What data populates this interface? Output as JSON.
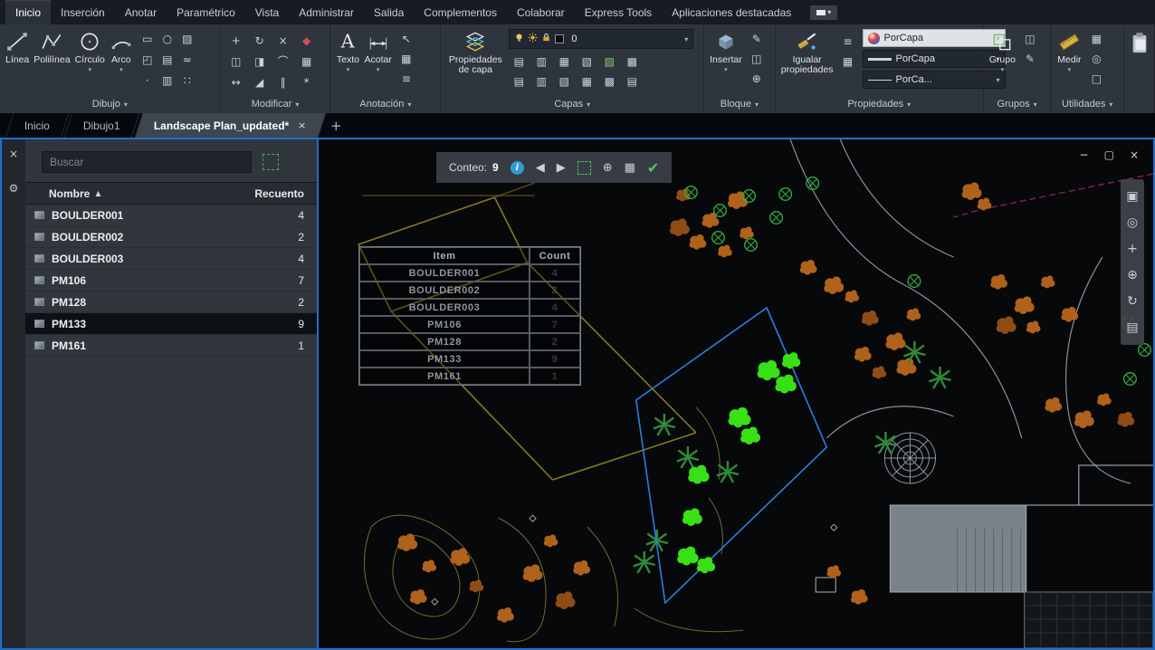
{
  "menubar": {
    "items": [
      "Inicio",
      "Inserción",
      "Anotar",
      "Paramétrico",
      "Vista",
      "Administrar",
      "Salida",
      "Complementos",
      "Colaborar",
      "Express Tools",
      "Aplicaciones destacadas"
    ],
    "active": "Inicio",
    "overflow_caret": "▾"
  },
  "ribbon": {
    "caret": "▾",
    "dibujo": {
      "label": "Dibujo",
      "line": "Línea",
      "polyline": "Polilínea",
      "circle": "Círculo",
      "arc": "Arco",
      "icons": [
        {
          "name": "rectangle-icon",
          "glyph": "▭"
        },
        {
          "name": "ellipse-icon",
          "glyph": "○"
        },
        {
          "name": "hatch-icon",
          "glyph": "▨"
        },
        {
          "name": "boundary-icon",
          "glyph": "◰"
        },
        {
          "name": "region-icon",
          "glyph": "▤"
        },
        {
          "name": "spline-icon",
          "glyph": "≈"
        },
        {
          "name": "point-icon",
          "glyph": "·"
        },
        {
          "name": "gradient-icon",
          "glyph": "▥"
        },
        {
          "name": "divide-icon",
          "glyph": "∷"
        }
      ]
    },
    "modificar": {
      "label": "Modificar",
      "icons": [
        {
          "name": "move-icon",
          "glyph": "+"
        },
        {
          "name": "rotate-icon",
          "glyph": "↻"
        },
        {
          "name": "trim-icon",
          "glyph": "×"
        },
        {
          "name": "erase-icon",
          "glyph": "◆",
          "color": "#cf5050"
        },
        {
          "name": "copy-icon",
          "glyph": "◫"
        },
        {
          "name": "mirror-icon",
          "glyph": "◨"
        },
        {
          "name": "fillet-icon",
          "glyph": "⌒"
        },
        {
          "name": "array-icon",
          "glyph": "▦"
        },
        {
          "name": "stretch-icon",
          "glyph": "↔"
        },
        {
          "name": "scale-icon",
          "glyph": "◢"
        },
        {
          "name": "offset-icon",
          "glyph": "∥"
        },
        {
          "name": "explode-icon",
          "glyph": "*"
        }
      ]
    },
    "anotacion": {
      "label": "Anotación",
      "text": "Texto",
      "dimension": "Acotar",
      "icons": [
        {
          "name": "leader-icon",
          "glyph": "↖"
        },
        {
          "name": "table-icon",
          "glyph": "▦"
        },
        {
          "name": "text-style-icon",
          "glyph": "≡"
        }
      ]
    },
    "capas": {
      "label": "Capas",
      "layer_properties": "Propiedades de capa",
      "current_layer": "0",
      "icons": [
        {
          "name": "layer-off-icon",
          "glyph": "▤"
        },
        {
          "name": "layer-isolate-icon",
          "glyph": "▥"
        },
        {
          "name": "layer-freeze-icon",
          "glyph": "▦"
        },
        {
          "name": "layer-lock-icon",
          "glyph": "▧"
        },
        {
          "name": "layer-current-icon",
          "glyph": "▨",
          "color": "#8fc97a"
        },
        {
          "name": "layer-match-icon",
          "glyph": "▩"
        },
        {
          "name": "layer-on-icon",
          "glyph": "▤"
        },
        {
          "name": "layer-thaw-icon",
          "glyph": "▥"
        },
        {
          "name": "layer-unlock-icon",
          "glyph": "▧"
        },
        {
          "name": "layer-walk-icon",
          "glyph": "▦"
        },
        {
          "name": "layer-state-icon",
          "glyph": "▩"
        },
        {
          "name": "layer-merge-icon",
          "glyph": "▤"
        }
      ]
    },
    "bloque": {
      "label": "Bloque",
      "insert": "Insertar",
      "icons": [
        {
          "name": "edit-block-icon",
          "glyph": "✎"
        },
        {
          "name": "create-block-icon",
          "glyph": "◫"
        },
        {
          "name": "base-point-icon",
          "glyph": "⊕"
        }
      ]
    },
    "propiedades": {
      "label": "Propiedades",
      "match": "Igualar propiedades",
      "color_value": "PorCapa",
      "lineweight_value": "PorCapa",
      "linetype_value": "PorCa...",
      "icons": [
        {
          "name": "properties-list-icon",
          "glyph": "≡"
        },
        {
          "name": "annotative-icon",
          "glyph": "▦"
        }
      ]
    },
    "grupos": {
      "label": "Grupos",
      "group": "Grupo",
      "icons": [
        {
          "name": "ungroup-icon",
          "glyph": "◫"
        },
        {
          "name": "group-edit-icon",
          "glyph": "✎"
        }
      ]
    },
    "utilidades": {
      "label": "Utilidades",
      "measure": "Medir",
      "icons": [
        {
          "name": "quick-calc-icon",
          "glyph": "▦"
        },
        {
          "name": "id-point-icon",
          "glyph": "◎"
        },
        {
          "name": "quick-select-icon",
          "glyph": "□"
        }
      ]
    }
  },
  "tabs": {
    "items": [
      {
        "label": "Inicio",
        "active": false
      },
      {
        "label": "Dibujo1",
        "active": false
      },
      {
        "label": "Landscape Plan_updated*",
        "active": true
      }
    ],
    "close_glyph": "×",
    "new_tab_glyph": "+"
  },
  "palette": {
    "search_placeholder": "Buscar",
    "name_header": "Nombre",
    "count_header": "Recuento",
    "sort_glyph": "▲",
    "close_glyph": "×",
    "settings_glyph": "⚙",
    "selected": "PM133",
    "rows": [
      {
        "name": "BOULDER001",
        "count": "4"
      },
      {
        "name": "BOULDER002",
        "count": "2"
      },
      {
        "name": "BOULDER003",
        "count": "4"
      },
      {
        "name": "PM106",
        "count": "7"
      },
      {
        "name": "PM128",
        "count": "2"
      },
      {
        "name": "PM133",
        "count": "9"
      },
      {
        "name": "PM161",
        "count": "1"
      }
    ]
  },
  "count_toolbar": {
    "label": "Conteo:",
    "value": "9",
    "icons": [
      {
        "name": "info-icon",
        "glyph": "i"
      },
      {
        "name": "prev-arrow-icon",
        "glyph": "◀"
      },
      {
        "name": "next-arrow-icon",
        "glyph": "▶"
      },
      {
        "name": "select-objects-icon",
        "glyph": ""
      },
      {
        "name": "zoom-to-icon",
        "glyph": "⊕"
      },
      {
        "name": "create-table-icon",
        "glyph": "▦"
      },
      {
        "name": "finish-count-icon",
        "glyph": "✔"
      }
    ]
  },
  "drawing": {
    "window_buttons": [
      {
        "name": "minimize-button",
        "glyph": "−"
      },
      {
        "name": "restore-button",
        "glyph": "▢"
      },
      {
        "name": "close-button",
        "glyph": "×"
      }
    ],
    "navbar_icons": [
      {
        "name": "viewcube-icon",
        "glyph": "▣"
      },
      {
        "name": "steering-wheel-icon",
        "glyph": "◎"
      },
      {
        "name": "pan-icon",
        "glyph": "+"
      },
      {
        "name": "zoom-icon",
        "glyph": "⊕"
      },
      {
        "name": "orbit-icon",
        "glyph": "↻"
      },
      {
        "name": "show-motion-icon",
        "glyph": "▤"
      }
    ],
    "table": {
      "headers": [
        "Item",
        "Count"
      ],
      "rows": [
        [
          "BOULDER001",
          "4"
        ],
        [
          "BOULDER002",
          "2"
        ],
        [
          "BOULDER003",
          "4"
        ],
        [
          "PM106",
          "7"
        ],
        [
          "PM128",
          "2"
        ],
        [
          "PM133",
          "9"
        ],
        [
          "PM161",
          "1"
        ]
      ]
    }
  }
}
